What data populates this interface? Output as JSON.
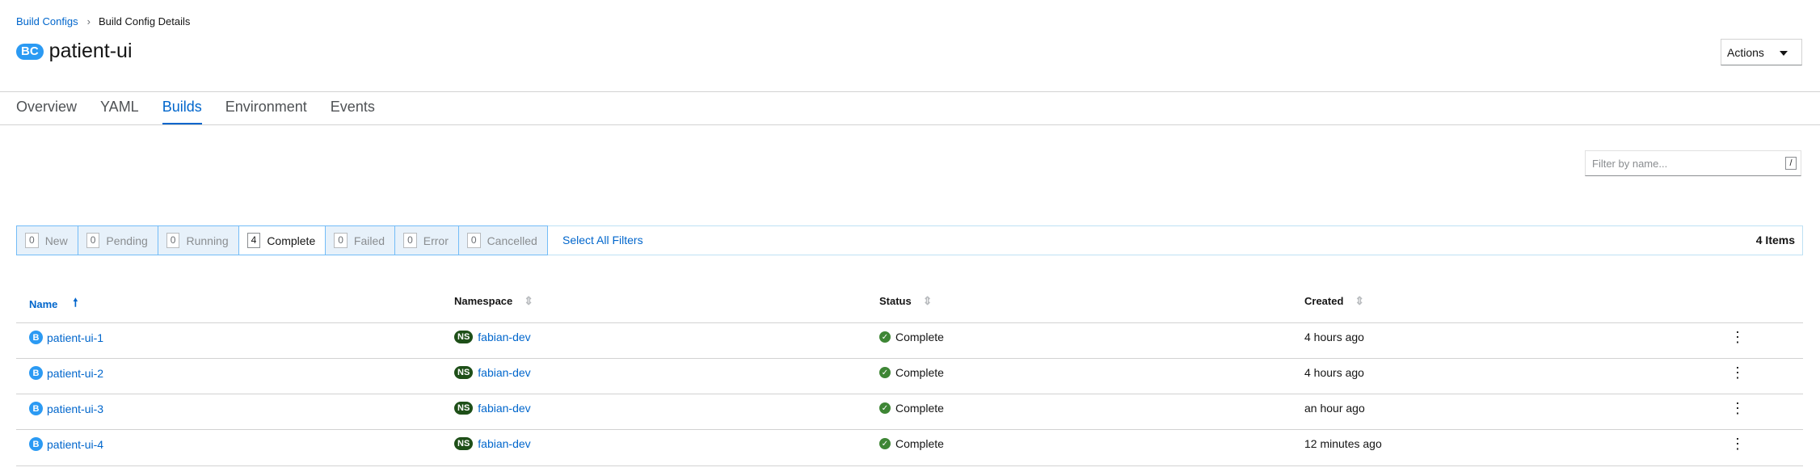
{
  "breadcrumb": {
    "parent": "Build Configs",
    "current": "Build Config Details"
  },
  "header": {
    "badge": "BC",
    "title": "patient-ui",
    "actions_label": "Actions"
  },
  "tabs": [
    {
      "label": "Overview"
    },
    {
      "label": "YAML"
    },
    {
      "label": "Builds"
    },
    {
      "label": "Environment"
    },
    {
      "label": "Events"
    }
  ],
  "active_tab": "Builds",
  "filter": {
    "placeholder": "Filter by name...",
    "shortcut": "/"
  },
  "status_filters": [
    {
      "count": "0",
      "label": "New"
    },
    {
      "count": "0",
      "label": "Pending"
    },
    {
      "count": "0",
      "label": "Running"
    },
    {
      "count": "4",
      "label": "Complete"
    },
    {
      "count": "0",
      "label": "Failed"
    },
    {
      "count": "0",
      "label": "Error"
    },
    {
      "count": "0",
      "label": "Cancelled"
    }
  ],
  "select_all_label": "Select All Filters",
  "items_count": "4 Items",
  "table": {
    "columns": [
      "Name",
      "Namespace",
      "Status",
      "Created"
    ],
    "rows": [
      {
        "name": "patient-ui-1",
        "namespace": "fabian-dev",
        "status": "Complete",
        "created": "4 hours ago"
      },
      {
        "name": "patient-ui-2",
        "namespace": "fabian-dev",
        "status": "Complete",
        "created": "4 hours ago"
      },
      {
        "name": "patient-ui-3",
        "namespace": "fabian-dev",
        "status": "Complete",
        "created": "an hour ago"
      },
      {
        "name": "patient-ui-4",
        "namespace": "fabian-dev",
        "status": "Complete",
        "created": "12 minutes ago"
      }
    ],
    "resource_badge": "B",
    "namespace_badge": "NS"
  },
  "colors": {
    "link": "#0066cc",
    "accent_badge": "#2b9af3",
    "ns_badge": "#1e4f18",
    "success": "#3e8635"
  },
  "icons": {
    "sort_asc": "arrow-up-icon",
    "sort_none": "sort-icon",
    "status_ok": "check-circle-icon",
    "row_menu": "kebab-icon"
  }
}
